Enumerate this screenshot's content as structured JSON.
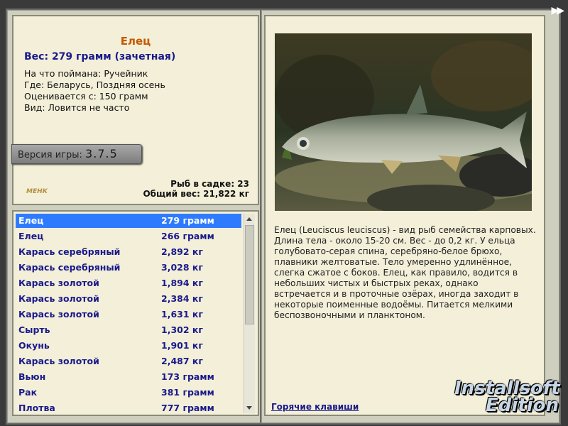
{
  "info": {
    "fish_name": "Елец",
    "weight_line": "Вес: 279 грамм (зачетная)",
    "caught_on": "На что поймана: Ручейник",
    "where": "Где: Беларусь, Поздняя осень",
    "valued_from": "Оценивается с: 150 грамм",
    "rarity": "Вид: Ловится не часто",
    "version_label": "Версия игры:",
    "version_value": "3.7.5",
    "logo_text": "МЕНК",
    "fish_in_cage": "Рыб в садке: 23",
    "total_weight": "Общий вес: 21,822 кг"
  },
  "catch_list": [
    {
      "name": "Елец",
      "weight": "279 грамм",
      "selected": true
    },
    {
      "name": "Елец",
      "weight": "266 грамм"
    },
    {
      "name": "Карась серебряный",
      "weight": "2,892 кг"
    },
    {
      "name": "Карась серебряный",
      "weight": "3,028 кг"
    },
    {
      "name": "Карась золотой",
      "weight": "1,894 кг"
    },
    {
      "name": "Карась золотой",
      "weight": "2,384 кг"
    },
    {
      "name": "Карась золотой",
      "weight": "1,631 кг"
    },
    {
      "name": "Сырть",
      "weight": "1,302 кг"
    },
    {
      "name": "Окунь",
      "weight": "1,901 кг"
    },
    {
      "name": "Карась золотой",
      "weight": "2,487 кг"
    },
    {
      "name": "Вьюн",
      "weight": "173 грамм"
    },
    {
      "name": "Рак",
      "weight": "381 грамм"
    },
    {
      "name": "Плотва",
      "weight": "777 грамм"
    }
  ],
  "description": {
    "text": "Елец (Leuciscus leuciscus) - вид рыб семейства карповых. Длина тела - около 15-20 см. Вес - до 0,2 кг. У ельца голубовато-серая спина, серебряно-белое брюхо, плавники желтоватые. Тело умеренно удлинённое, слегка сжатое с боков. Елец, как правило, водится в небольших чистых и быстрых реках, однако встречается и в проточные озёрах, иногда заходит в некоторые поименные водоёмы. Питается мелкими беспозвоночными и планктоном.",
    "hotkeys_link": "Горячие клавиши"
  },
  "top_right": {
    "icon": "fast-forward-icon",
    "glyph": "▶▶"
  },
  "watermark": {
    "line1": "Installsoft",
    "line2": "Edition"
  },
  "colors": {
    "accent_title": "#c45a00",
    "text_blue": "#1a1a8c",
    "selection": "#2f7bff",
    "panel_bg": "#f3efd8"
  }
}
